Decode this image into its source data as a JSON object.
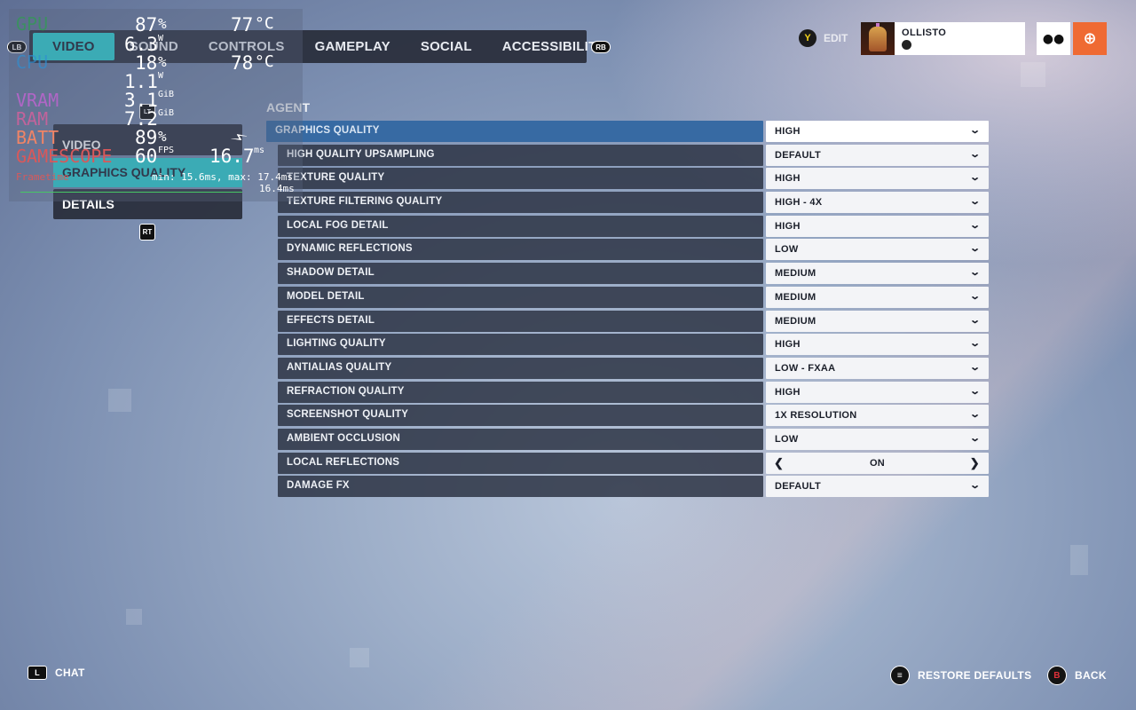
{
  "tabs": [
    {
      "label": "VIDEO",
      "active": true
    },
    {
      "label": "SOUND",
      "active": false
    },
    {
      "label": "CONTROLS",
      "active": false
    },
    {
      "label": "GAMEPLAY",
      "active": false
    },
    {
      "label": "SOCIAL",
      "active": false
    },
    {
      "label": "ACCESSIBILITY",
      "active": false
    }
  ],
  "glyphs": {
    "lb": "LB",
    "rb": "RB",
    "lt": "LT",
    "rt": "RT",
    "y": "Y",
    "b": "B",
    "l": "L"
  },
  "profile": {
    "edit_label": "EDIT",
    "name": "OLLISTO",
    "platform_icon": "steam-icon"
  },
  "side_menu": {
    "header": "VIDEO",
    "items": [
      {
        "label": "GRAPHICS QUALITY",
        "active": true
      },
      {
        "label": "DETAILS",
        "active": false
      }
    ]
  },
  "section": {
    "title": "AGENT"
  },
  "settings": [
    {
      "label": "GRAPHICS QUALITY",
      "value": "HIGH",
      "type": "dropdown",
      "header": true
    },
    {
      "label": "HIGH QUALITY UPSAMPLING",
      "value": "DEFAULT",
      "type": "dropdown"
    },
    {
      "label": "TEXTURE QUALITY",
      "value": "HIGH",
      "type": "dropdown"
    },
    {
      "label": "TEXTURE FILTERING QUALITY",
      "value": "HIGH - 4X",
      "type": "dropdown"
    },
    {
      "label": "LOCAL FOG DETAIL",
      "value": "HIGH",
      "type": "dropdown"
    },
    {
      "label": "DYNAMIC REFLECTIONS",
      "value": "LOW",
      "type": "dropdown"
    },
    {
      "label": "SHADOW DETAIL",
      "value": "MEDIUM",
      "type": "dropdown"
    },
    {
      "label": "MODEL DETAIL",
      "value": "MEDIUM",
      "type": "dropdown"
    },
    {
      "label": "EFFECTS DETAIL",
      "value": "MEDIUM",
      "type": "dropdown"
    },
    {
      "label": "LIGHTING QUALITY",
      "value": "HIGH",
      "type": "dropdown"
    },
    {
      "label": "ANTIALIAS QUALITY",
      "value": "LOW - FXAA",
      "type": "dropdown"
    },
    {
      "label": "REFRACTION QUALITY",
      "value": "HIGH",
      "type": "dropdown"
    },
    {
      "label": "SCREENSHOT QUALITY",
      "value": "1X RESOLUTION",
      "type": "dropdown"
    },
    {
      "label": "AMBIENT OCCLUSION",
      "value": "LOW",
      "type": "dropdown"
    },
    {
      "label": "LOCAL REFLECTIONS",
      "value": "ON",
      "type": "toggle"
    },
    {
      "label": "DAMAGE FX",
      "value": "DEFAULT",
      "type": "dropdown"
    }
  ],
  "bottom": {
    "chat": "CHAT",
    "restore_defaults": "RESTORE DEFAULTS",
    "back": "BACK"
  },
  "osd": {
    "gpu_label": "GPU",
    "gpu_load": "87",
    "gpu_load_unit": "%",
    "gpu_power": "6.3",
    "gpu_power_unit": "W",
    "gpu_temp": "77",
    "gpu_temp_unit": "°C",
    "cpu_label": "CPU",
    "cpu_load": "18",
    "cpu_load_unit": "%",
    "cpu_power": "1.1",
    "cpu_power_unit": "W",
    "cpu_temp": "78",
    "cpu_temp_unit": "°C",
    "vram_label": "VRAM",
    "vram": "3.1",
    "vram_unit": "GiB",
    "ram_label": "RAM",
    "ram": "7.2",
    "ram_unit": "GiB",
    "batt_label": "BATT",
    "batt": "89",
    "batt_unit": "%",
    "gamescope_label": "GAMESCOPE",
    "fps": "60",
    "fps_unit": "FPS",
    "frametime": "16.7",
    "frametime_unit": "ms",
    "frametime_label": "Frametime",
    "frametime_minmax": "min: 15.6ms, max: 17.4ms",
    "frametime_current": "16.4ms",
    "colors": {
      "gpu": "#2e9e4f",
      "cpu": "#2f8fd1",
      "vram": "#b066c6",
      "ram": "#c2639b",
      "batt": "#f08466",
      "gamescope": "#d9585a",
      "frametime": "#d9585a"
    }
  }
}
